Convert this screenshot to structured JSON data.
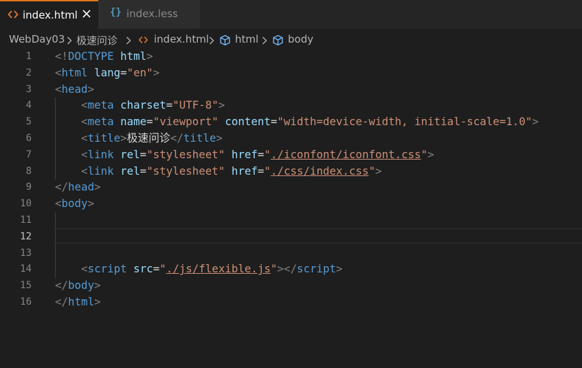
{
  "tabs": [
    {
      "label": "index.html",
      "active": true,
      "icon": "html-icon",
      "icon_color": "#e37933"
    },
    {
      "label": "index.less",
      "active": false,
      "icon": "braces-icon",
      "icon_color": "#519aba"
    }
  ],
  "breadcrumb": {
    "folder": "WebDay03",
    "subfolder": "极速问诊",
    "file": "index.html",
    "symbol1": "html",
    "symbol2": "body"
  },
  "editor": {
    "current_line": 12,
    "line_numbers": [
      "1",
      "2",
      "3",
      "4",
      "5",
      "6",
      "7",
      "8",
      "9",
      "10",
      "11",
      "12",
      "13",
      "14",
      "15",
      "16"
    ],
    "lines": [
      [
        {
          "t": "<!",
          "c": "br"
        },
        {
          "t": "DOCTYPE",
          "c": "tg"
        },
        {
          "t": " ",
          "c": "tx"
        },
        {
          "t": "html",
          "c": "at"
        },
        {
          "t": ">",
          "c": "br"
        }
      ],
      [
        {
          "t": "<",
          "c": "br"
        },
        {
          "t": "html",
          "c": "tg"
        },
        {
          "t": " ",
          "c": "tx"
        },
        {
          "t": "lang",
          "c": "at"
        },
        {
          "t": "=",
          "c": "tx"
        },
        {
          "t": "\"en\"",
          "c": "st"
        },
        {
          "t": ">",
          "c": "br"
        }
      ],
      [
        {
          "t": "<",
          "c": "br"
        },
        {
          "t": "head",
          "c": "tg"
        },
        {
          "t": ">",
          "c": "br"
        }
      ],
      [
        {
          "t": "    ",
          "c": "tx"
        },
        {
          "t": "<",
          "c": "br"
        },
        {
          "t": "meta",
          "c": "tg"
        },
        {
          "t": " ",
          "c": "tx"
        },
        {
          "t": "charset",
          "c": "at"
        },
        {
          "t": "=",
          "c": "tx"
        },
        {
          "t": "\"UTF-8\"",
          "c": "st"
        },
        {
          "t": ">",
          "c": "br"
        }
      ],
      [
        {
          "t": "    ",
          "c": "tx"
        },
        {
          "t": "<",
          "c": "br"
        },
        {
          "t": "meta",
          "c": "tg"
        },
        {
          "t": " ",
          "c": "tx"
        },
        {
          "t": "name",
          "c": "at"
        },
        {
          "t": "=",
          "c": "tx"
        },
        {
          "t": "\"viewport\"",
          "c": "st"
        },
        {
          "t": " ",
          "c": "tx"
        },
        {
          "t": "content",
          "c": "at"
        },
        {
          "t": "=",
          "c": "tx"
        },
        {
          "t": "\"width=device-width, initial-scale=1.0\"",
          "c": "st"
        },
        {
          "t": ">",
          "c": "br"
        }
      ],
      [
        {
          "t": "    ",
          "c": "tx"
        },
        {
          "t": "<",
          "c": "br"
        },
        {
          "t": "title",
          "c": "tg"
        },
        {
          "t": ">",
          "c": "br"
        },
        {
          "t": "极速问诊",
          "c": "tx"
        },
        {
          "t": "</",
          "c": "br"
        },
        {
          "t": "title",
          "c": "tg"
        },
        {
          "t": ">",
          "c": "br"
        }
      ],
      [
        {
          "t": "    ",
          "c": "tx"
        },
        {
          "t": "<",
          "c": "br"
        },
        {
          "t": "link",
          "c": "tg"
        },
        {
          "t": " ",
          "c": "tx"
        },
        {
          "t": "rel",
          "c": "at"
        },
        {
          "t": "=",
          "c": "tx"
        },
        {
          "t": "\"stylesheet\"",
          "c": "st"
        },
        {
          "t": " ",
          "c": "tx"
        },
        {
          "t": "href",
          "c": "at"
        },
        {
          "t": "=",
          "c": "tx"
        },
        {
          "t": "\"",
          "c": "st"
        },
        {
          "t": "./iconfont/iconfont.css",
          "c": "st ul"
        },
        {
          "t": "\"",
          "c": "st"
        },
        {
          "t": ">",
          "c": "br"
        }
      ],
      [
        {
          "t": "    ",
          "c": "tx"
        },
        {
          "t": "<",
          "c": "br"
        },
        {
          "t": "link",
          "c": "tg"
        },
        {
          "t": " ",
          "c": "tx"
        },
        {
          "t": "rel",
          "c": "at"
        },
        {
          "t": "=",
          "c": "tx"
        },
        {
          "t": "\"stylesheet\"",
          "c": "st"
        },
        {
          "t": " ",
          "c": "tx"
        },
        {
          "t": "href",
          "c": "at"
        },
        {
          "t": "=",
          "c": "tx"
        },
        {
          "t": "\"",
          "c": "st"
        },
        {
          "t": "./css/index.css",
          "c": "st ul"
        },
        {
          "t": "\"",
          "c": "st"
        },
        {
          "t": ">",
          "c": "br"
        }
      ],
      [
        {
          "t": "</",
          "c": "br"
        },
        {
          "t": "head",
          "c": "tg"
        },
        {
          "t": ">",
          "c": "br"
        }
      ],
      [
        {
          "t": "<",
          "c": "br"
        },
        {
          "t": "body",
          "c": "tg"
        },
        {
          "t": ">",
          "c": "br"
        }
      ],
      [],
      [],
      [],
      [
        {
          "t": "    ",
          "c": "tx"
        },
        {
          "t": "<",
          "c": "br"
        },
        {
          "t": "script",
          "c": "tg"
        },
        {
          "t": " ",
          "c": "tx"
        },
        {
          "t": "src",
          "c": "at"
        },
        {
          "t": "=",
          "c": "tx"
        },
        {
          "t": "\"",
          "c": "st"
        },
        {
          "t": "./js/flexible.js",
          "c": "st ul"
        },
        {
          "t": "\"",
          "c": "st"
        },
        {
          "t": "></",
          "c": "br"
        },
        {
          "t": "script",
          "c": "tg"
        },
        {
          "t": ">",
          "c": "br"
        }
      ],
      [
        {
          "t": "</",
          "c": "br"
        },
        {
          "t": "body",
          "c": "tg"
        },
        {
          "t": ">",
          "c": "br"
        }
      ],
      [
        {
          "t": "</",
          "c": "br"
        },
        {
          "t": "html",
          "c": "tg"
        },
        {
          "t": ">",
          "c": "br"
        }
      ]
    ]
  }
}
